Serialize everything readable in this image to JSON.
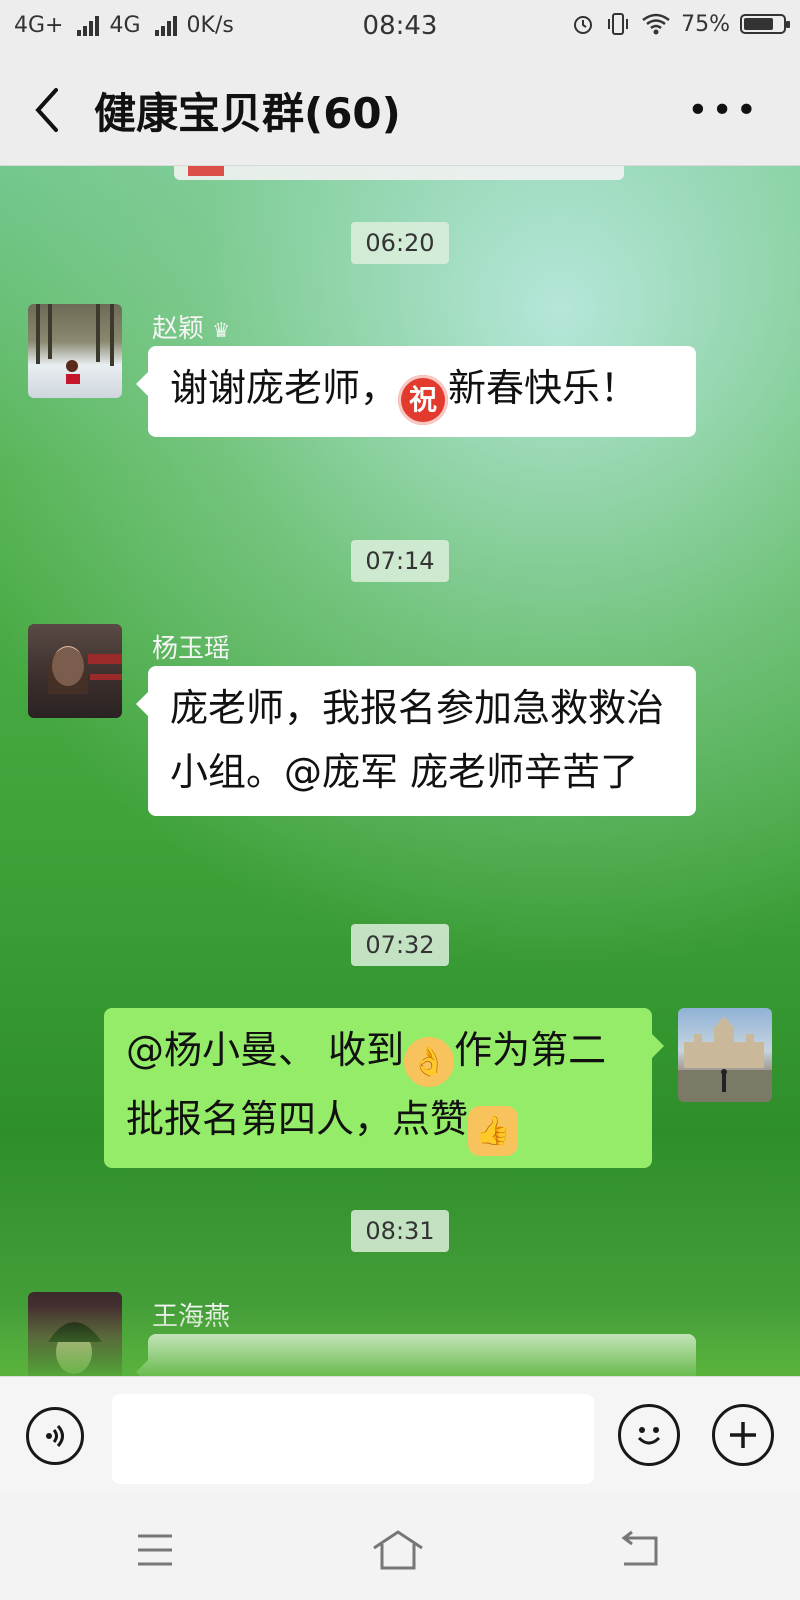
{
  "status_bar": {
    "network1": "4G+",
    "network2": "4G",
    "speed": "0K/s",
    "time": "08:43",
    "battery_percent": "75%",
    "battery_level": 0.75
  },
  "header": {
    "title": "健康宝贝群(60)"
  },
  "messages": [
    {
      "time": "06:20",
      "sender": "赵颖",
      "text_before": "谢谢庞老师，",
      "emoji": "祝",
      "text_after": "新春快乐！"
    },
    {
      "time": "07:14",
      "sender": "杨玉瑶",
      "text": "庞老师，我报名参加急救救治小组。@庞军  庞老师辛苦了"
    },
    {
      "time": "07:32",
      "text_part1": "@杨小曼、 收到",
      "emoji1": "ok-hand-emoji",
      "text_part2": "作为第二批报名第四人，点赞",
      "emoji2": "thumbs-up-emoji"
    },
    {
      "time": "08:31",
      "sender": "王海燕"
    }
  ],
  "colors": {
    "my_bubble": "#95ec69",
    "other_bubble": "#ffffff",
    "header_bg": "#ededed"
  }
}
